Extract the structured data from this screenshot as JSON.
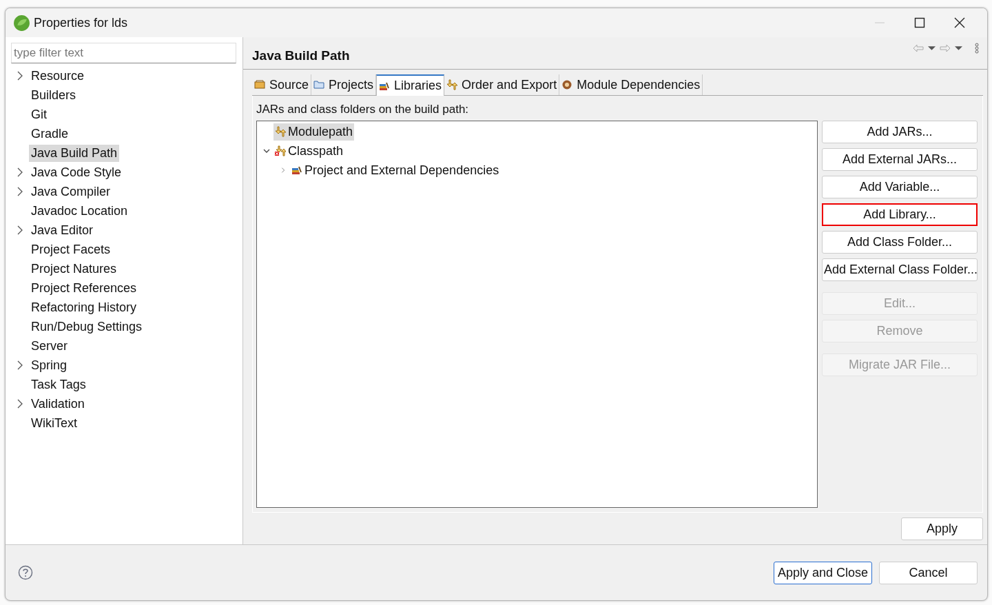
{
  "window": {
    "title": "Properties for lds"
  },
  "filter": {
    "placeholder": "type filter text"
  },
  "sidebar": {
    "items": [
      {
        "label": "Resource",
        "expandable": true,
        "selected": false
      },
      {
        "label": "Builders",
        "expandable": false,
        "selected": false
      },
      {
        "label": "Git",
        "expandable": false,
        "selected": false
      },
      {
        "label": "Gradle",
        "expandable": false,
        "selected": false
      },
      {
        "label": "Java Build Path",
        "expandable": false,
        "selected": true
      },
      {
        "label": "Java Code Style",
        "expandable": true,
        "selected": false
      },
      {
        "label": "Java Compiler",
        "expandable": true,
        "selected": false
      },
      {
        "label": "Javadoc Location",
        "expandable": false,
        "selected": false
      },
      {
        "label": "Java Editor",
        "expandable": true,
        "selected": false
      },
      {
        "label": "Project Facets",
        "expandable": false,
        "selected": false
      },
      {
        "label": "Project Natures",
        "expandable": false,
        "selected": false
      },
      {
        "label": "Project References",
        "expandable": false,
        "selected": false
      },
      {
        "label": "Refactoring History",
        "expandable": false,
        "selected": false
      },
      {
        "label": "Run/Debug Settings",
        "expandable": false,
        "selected": false
      },
      {
        "label": "Server",
        "expandable": false,
        "selected": false
      },
      {
        "label": "Spring",
        "expandable": true,
        "selected": false
      },
      {
        "label": "Task Tags",
        "expandable": false,
        "selected": false
      },
      {
        "label": "Validation",
        "expandable": true,
        "selected": false
      },
      {
        "label": "WikiText",
        "expandable": false,
        "selected": false
      }
    ]
  },
  "page": {
    "title": "Java Build Path"
  },
  "tabs": [
    {
      "label": "Source",
      "kind": "source",
      "selected": false
    },
    {
      "label": "Projects",
      "kind": "projects",
      "selected": false
    },
    {
      "label": "Libraries",
      "kind": "libraries",
      "selected": true
    },
    {
      "label": "Order and Export",
      "kind": "order",
      "selected": false
    },
    {
      "label": "Module Dependencies",
      "kind": "module",
      "selected": false
    }
  ],
  "libraries": {
    "caption": "JARs and class folders on the build path:",
    "tree": [
      {
        "label": "Modulepath",
        "kind": "modulepath",
        "selected": true
      },
      {
        "label": "Classpath",
        "kind": "classpath",
        "selected": false,
        "expanded": true,
        "children": [
          {
            "label": "Project and External Dependencies",
            "kind": "libraries",
            "selected": false,
            "expanded": false
          }
        ]
      }
    ],
    "button_groups": [
      [
        {
          "label": "Add JARs...",
          "disabled": false,
          "highlighted": false
        },
        {
          "label": "Add External JARs...",
          "disabled": false,
          "highlighted": false
        },
        {
          "label": "Add Variable...",
          "disabled": false,
          "highlighted": false
        },
        {
          "label": "Add Library...",
          "disabled": false,
          "highlighted": true
        },
        {
          "label": "Add Class Folder...",
          "disabled": false,
          "highlighted": false
        },
        {
          "label": "Add External Class Folder...",
          "disabled": false,
          "highlighted": false
        }
      ],
      [
        {
          "label": "Edit...",
          "disabled": true,
          "highlighted": false
        },
        {
          "label": "Remove",
          "disabled": true,
          "highlighted": false
        }
      ],
      [
        {
          "label": "Migrate JAR File...",
          "disabled": true,
          "highlighted": false
        }
      ]
    ]
  },
  "apply_button": "Apply",
  "footer": {
    "buttons": [
      {
        "label": "Apply and Close",
        "default": true
      },
      {
        "label": "Cancel",
        "default": false
      }
    ]
  }
}
